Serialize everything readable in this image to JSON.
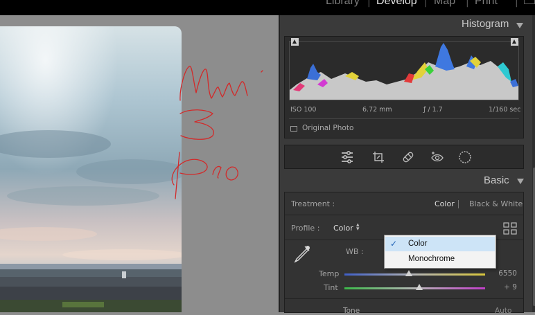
{
  "modules": [
    "Library",
    "Develop",
    "Map",
    "Print"
  ],
  "active_module": "Develop",
  "histogram": {
    "title": "Histogram",
    "iso": "ISO 100",
    "focal": "6.72 mm",
    "aperture": "ƒ / 1.7",
    "shutter": "1/160 sec",
    "original_photo_label": "Original Photo"
  },
  "basic": {
    "title": "Basic",
    "treatment_label": "Treatment :",
    "treatment_color": "Color",
    "treatment_bw": "Black & White",
    "profile_label": "Profile :",
    "profile_value": "Color",
    "wb_label": "WB :",
    "temp_label": "Temp",
    "temp_value": "6550",
    "temp_level": 0.46,
    "tint_label": "Tint",
    "tint_value": "+ 9",
    "tint_level": 0.53,
    "tone_label": "Tone",
    "auto_label": "Auto"
  },
  "profile_menu": {
    "items": [
      "Color",
      "Monochrome"
    ],
    "selected": "Color"
  },
  "colors": {
    "panel_bg": "#3a3a3a",
    "menu_selected": "#cde4f7",
    "scribble": "#d22a2a"
  }
}
